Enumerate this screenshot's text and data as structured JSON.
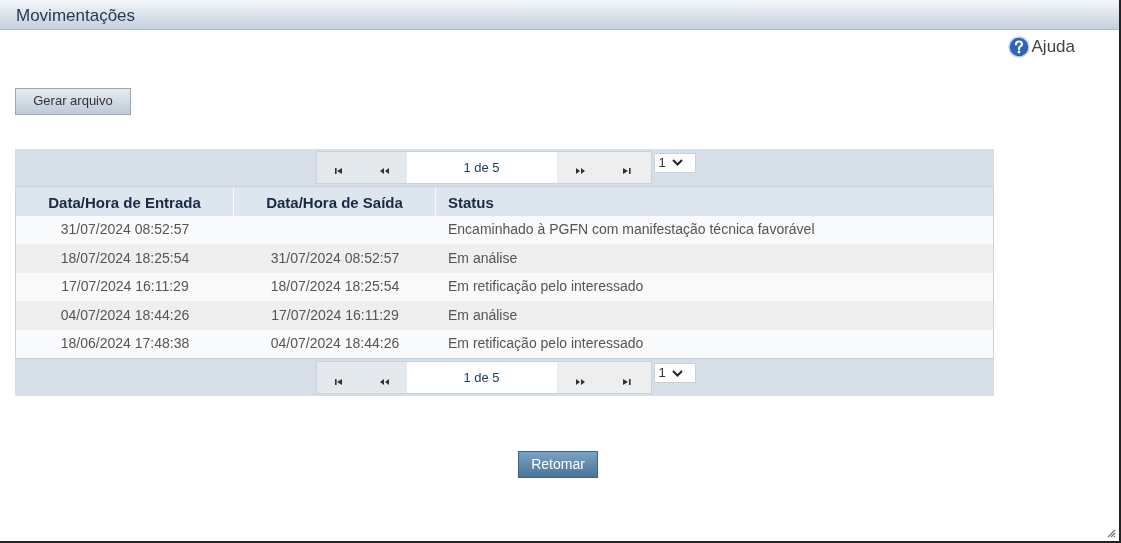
{
  "window": {
    "title": "Movimentações"
  },
  "help_link": "Ajuda",
  "generate_button": "Gerar arquivo",
  "pagers": [
    {
      "label": "1 de 5",
      "page_select": "1"
    },
    {
      "label": "1 de 5",
      "page_select": "1"
    }
  ],
  "table": {
    "columns": [
      "Data/Hora de Entrada",
      "Data/Hora de Saída",
      "Status"
    ],
    "rows": [
      [
        "31/07/2024 08:52:57",
        "",
        "Encaminhado à PGFN com manifestação técnica favorável"
      ],
      [
        "18/07/2024 18:25:54",
        "31/07/2024 08:52:57",
        "Em análise"
      ],
      [
        "17/07/2024 16:11:29",
        "18/07/2024 18:25:54",
        "Em retificação pelo interessado"
      ],
      [
        "04/07/2024 18:44:26",
        "17/07/2024 16:11:29",
        "Em análise"
      ],
      [
        "18/06/2024 17:48:38",
        "04/07/2024 18:44:26",
        "Em retificação pelo interessado"
      ]
    ]
  },
  "return_button": "Retomar"
}
